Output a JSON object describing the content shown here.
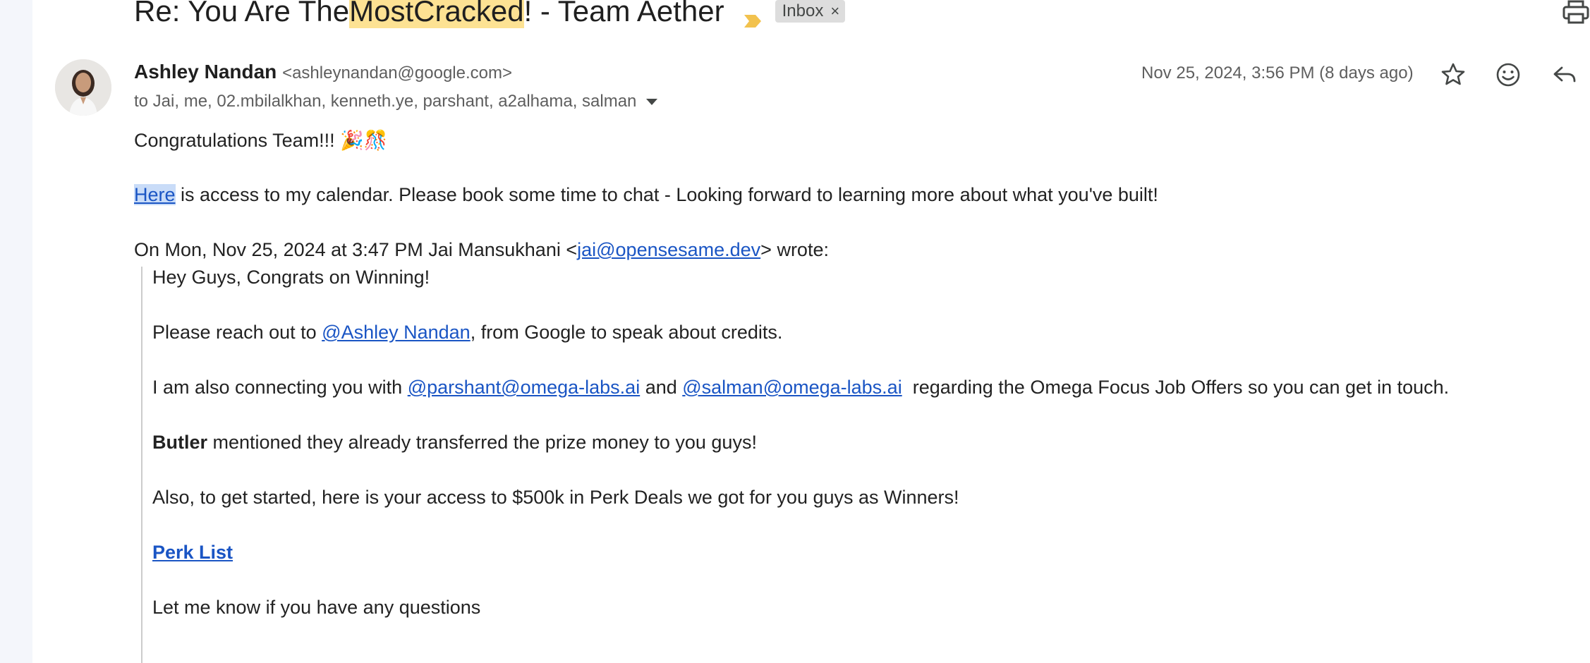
{
  "subject": {
    "prefix": "Re: You Are The ",
    "highlight1": "Most",
    "space": " ",
    "highlight2": "Cracked",
    "suffix": "! - Team Aether",
    "label_chip": "Inbox",
    "chip_close": "×"
  },
  "sender": {
    "name": "Ashley Nandan",
    "email": "<ashleynandan@google.com>",
    "recipients": "to Jai, me, 02.mbilalkhan, kenneth.ye, parshant, a2alhama, salman",
    "date": "Nov 25, 2024, 3:56 PM (8 days ago)"
  },
  "message": {
    "greeting": "Congratulations Team!!! 🎉🎊",
    "link_text": "Here",
    "line2": " is access to my calendar. Please book some time to chat - Looking forward to learning more about what you've built!",
    "quote_header_pre": "On Mon, Nov 25, 2024 at 3:47 PM Jai Mansukhani <",
    "quote_header_email": "jai@opensesame.dev",
    "quote_header_post": "> wrote:"
  },
  "quoted": {
    "line1": "Hey Guys, Congrats on Winning!",
    "line2_pre": "Please reach out to ",
    "line2_mention": "@Ashley Nandan",
    "line2_post": ", from Google to speak about credits.",
    "line3_pre": "I am also connecting you with ",
    "line3_mention1": "@parshant@omega-labs.ai",
    "line3_and": " and ",
    "line3_mention2": "@salman@omega-labs.ai",
    "line3_post": "  regarding the Omega Focus Job Offers so you can get in touch.",
    "line4_bold": "Butler",
    "line4_post": " mentioned they already transferred the prize money to you guys!",
    "line5": "Also, to get started, here is your access to $500k in Perk Deals we got for you guys as Winners!",
    "perk_link": "Perk List",
    "line6": "Let me know if you have any questions"
  },
  "icons": [
    "importance-marker-icon",
    "print-icon",
    "star-icon",
    "emoji-icon",
    "reply-icon",
    "dropdown-caret-icon"
  ],
  "colors": {
    "highlight": "#fde293",
    "link": "#1a55c4",
    "importance": "#f2c24e",
    "chip_bg": "#dddddd"
  }
}
